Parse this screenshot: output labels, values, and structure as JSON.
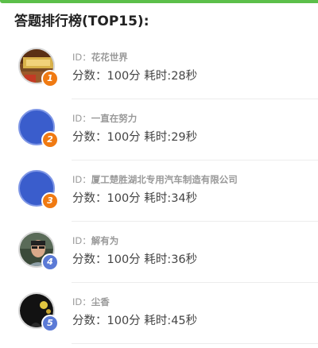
{
  "header": {
    "title": "答题排行榜(TOP15):"
  },
  "colors": {
    "accent_green": "#5cbf4a",
    "rank_orange": "#f07a12",
    "rank_blue": "#5b7ad6",
    "placeholder_avatar": "#3a5dcc"
  },
  "ranking": [
    {
      "rank": "1",
      "id_label": "ID：",
      "name": "花花世界",
      "score_label": "分数：",
      "score": "100分",
      "time_label": "耗时:",
      "time": "28秒",
      "avatar": "photo-desk"
    },
    {
      "rank": "2",
      "id_label": "ID：",
      "name": "一直在努力",
      "score_label": "分数：",
      "score": "100分",
      "time_label": "耗时:",
      "time": "29秒",
      "avatar": "blue-placeholder"
    },
    {
      "rank": "3",
      "id_label": "ID：",
      "name": "厦工楚胜湖北专用汽车制造有限公司",
      "score_label": "分数：",
      "score": "100分",
      "time_label": "耗时:",
      "time": "34秒",
      "avatar": "blue-placeholder"
    },
    {
      "rank": "4",
      "id_label": "ID：",
      "name": "解有为",
      "score_label": "分数：",
      "score": "100分",
      "time_label": "耗时:",
      "time": "36秒",
      "avatar": "photo-person"
    },
    {
      "rank": "5",
      "id_label": "ID：",
      "name": "尘香",
      "score_label": "分数：",
      "score": "100分",
      "time_label": "耗时:",
      "time": "45秒",
      "avatar": "photo-night"
    }
  ]
}
